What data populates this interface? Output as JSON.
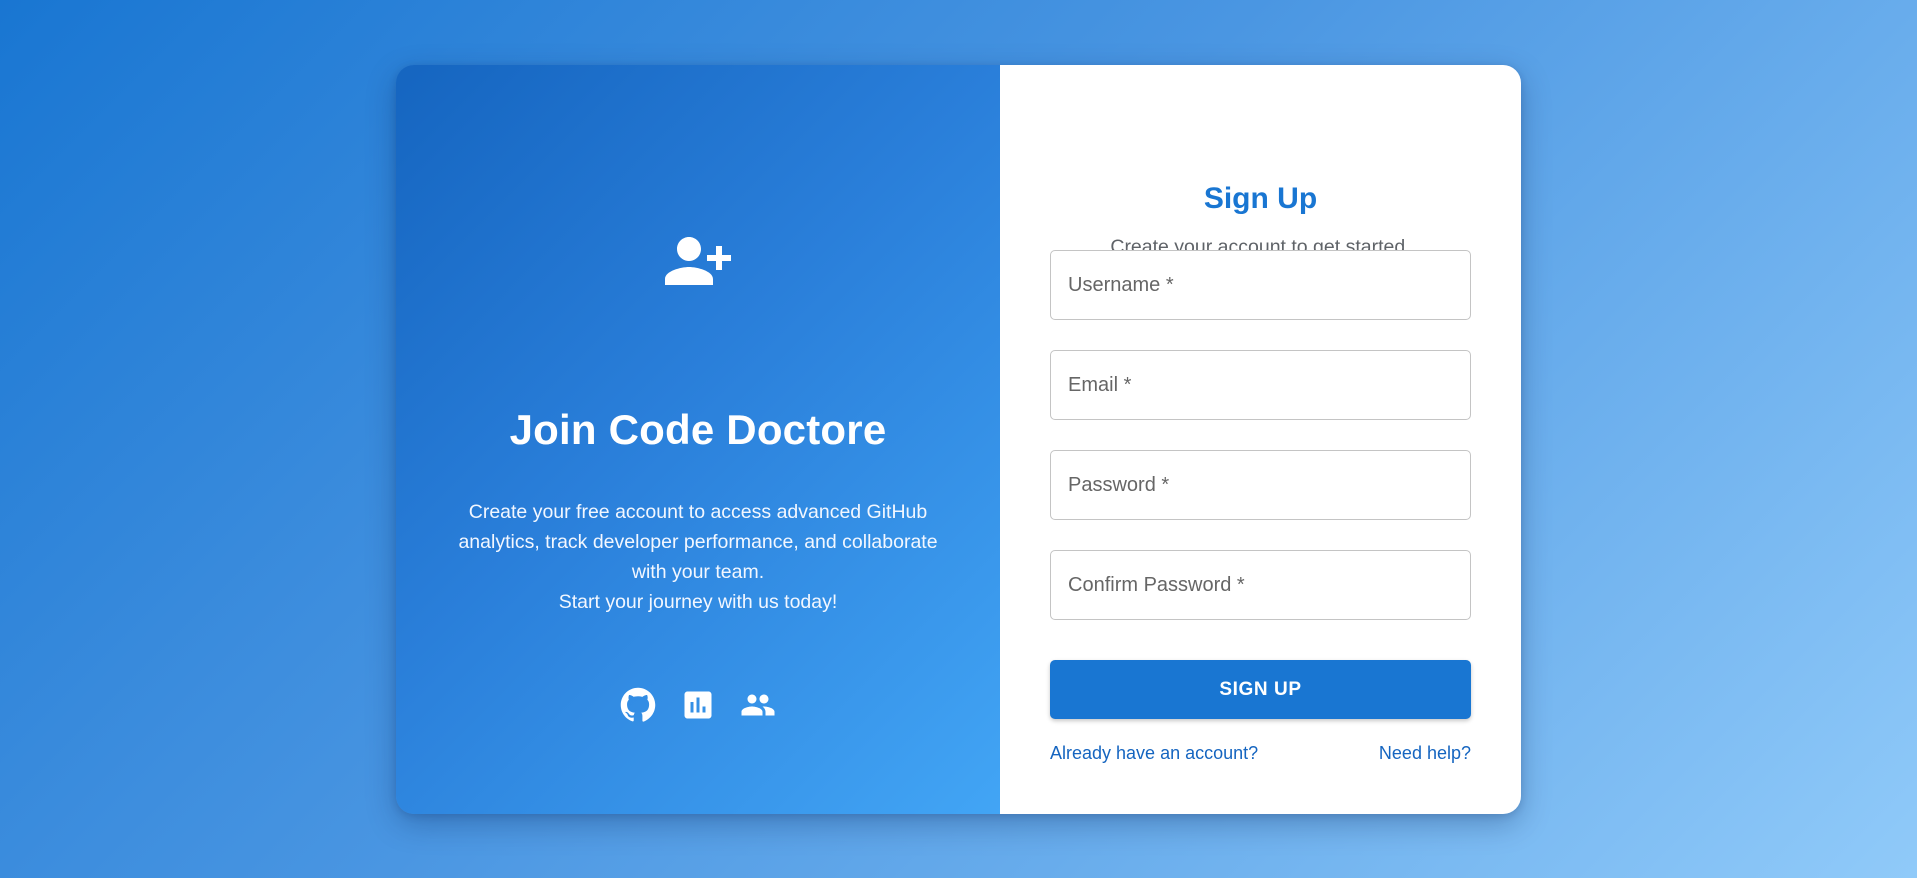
{
  "brand_panel": {
    "title": "Join Code Doctore",
    "description_lines": [
      "Create your free account to access advanced GitHub",
      "analytics, track developer performance, and collaborate",
      "with your team.",
      "Start your journey with us today!"
    ],
    "hero_icon": "person-add-icon",
    "feature_icons": [
      "github-icon",
      "bar-chart-icon",
      "people-icon"
    ]
  },
  "form": {
    "title": "Sign Up",
    "subtitle": "Create your account to get started.",
    "fields": {
      "username": {
        "placeholder": "Username *",
        "value": ""
      },
      "email": {
        "placeholder": "Email *",
        "value": ""
      },
      "password": {
        "placeholder": "Password *",
        "value": ""
      },
      "confirm_password": {
        "placeholder": "Confirm Password *",
        "value": ""
      }
    },
    "submit_label": "SIGN UP",
    "login_link": "Already have an account?",
    "help_link": "Need help?"
  },
  "colors": {
    "accent": "#1976d2",
    "panel_gradient_start": "#1565c0",
    "panel_gradient_end": "#42a5f5",
    "card_background": "#ffffff"
  }
}
